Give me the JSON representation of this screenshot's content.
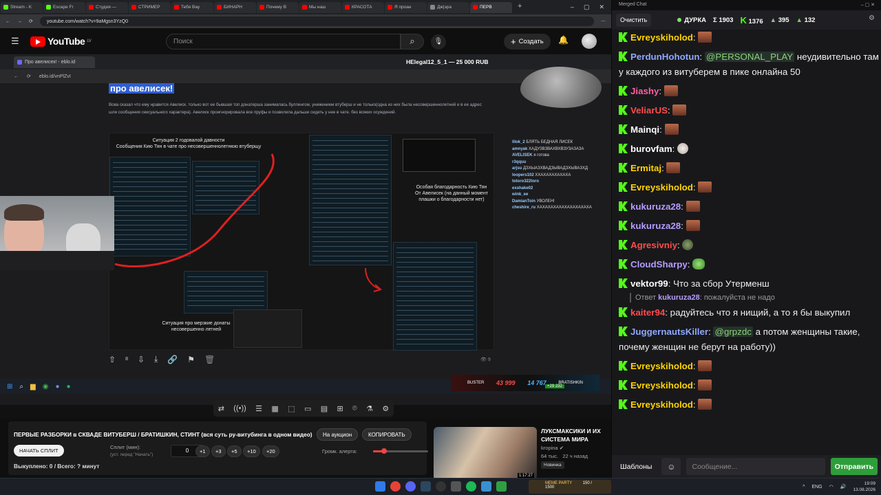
{
  "browser": {
    "tabs": [
      {
        "label": "Stream - K",
        "color": "#53fc18"
      },
      {
        "label": "Escape Fr",
        "color": "#53fc18"
      },
      {
        "label": "Студия —",
        "color": "#ff0000"
      },
      {
        "label": "СТРИМЕР",
        "color": "#ff0000"
      },
      {
        "label": "Тебя Вау",
        "color": "#ff0000"
      },
      {
        "label": "БИНАРН",
        "color": "#ff0000"
      },
      {
        "label": "Почему В",
        "color": "#ff0000"
      },
      {
        "label": "Мы наш",
        "color": "#ff0000"
      },
      {
        "label": "КРАСОТА",
        "color": "#ff0000"
      },
      {
        "label": "Я проан",
        "color": "#ff0000"
      },
      {
        "label": "Дж|эра",
        "color": "#888888"
      },
      {
        "label": "ПЕРВ",
        "color": "#ff0000"
      }
    ],
    "url": "youtube.com/watch?v=9aMgsn3YzQ0"
  },
  "youtube": {
    "logo": "YouTube",
    "region": "LV",
    "search_placeholder": "Поиск",
    "create_label": "Создать"
  },
  "video": {
    "inner_tab": "Про авелисек! - eblo.id",
    "inner_title": "HElegal12_5_1 — 25 000 RUB",
    "inner_url": "eblo.id/vnPlZvI",
    "article_heading": "про авелисек!",
    "article_text": "Вова сказал что ему нравится Авелиск. только вот ее бывшая топ донатерша занималась буллингом, унижением втуберш и не только(одна из них была несовершеннолетней и в ее адрес шли сообщения сексуального характера). Авелиск проигнорировала все пруфы и позволила дальше сидеть у нее в чате. без всяких осуждений.",
    "caption_1": "Ситуация 2 годовалой давности\nСообщения Кию Тян в чате про несовершеннолетнюю втуберщу",
    "caption_2": "Особая благодарность Кию Тян\nОт Авелисек (на данный момент\nплашки о благодарности нет)",
    "caption_3": "Ситуация про мерзкие донаты\nнесовершенно летней",
    "feed": [
      {
        "user": "lilok_2",
        "text": "БЛЯТЬ БЕДНАЯ ЛИСЕК"
      },
      {
        "user": "amnyak",
        "text": "ХАДУЗВЗВАХВХВЗУЗАЗАЗА"
      },
      {
        "user": "AVELISEK",
        "text": "я готова"
      },
      {
        "user": "r3qquu",
        "text": ""
      },
      {
        "user": "arjsu",
        "text": "ДЗХЫАЗХВАДЗЫВАДЗХЫВАЗХД"
      },
      {
        "user": "loopers102",
        "text": "ХХАХАХАХАХАХА"
      },
      {
        "user": "totoro322toro",
        "text": ""
      },
      {
        "user": "exshake02",
        "text": ""
      },
      {
        "user": "wink_ee",
        "text": ""
      },
      {
        "user": "DamianToin",
        "text": "УВОЛЕН!"
      },
      {
        "user": "cheshire_ru",
        "text": "ХАХАХАХАХАХАХАХАХАХА"
      }
    ],
    "likes": "8",
    "views": "9",
    "score_left_name": "BUSTER",
    "score_left": "43 999",
    "score_right_name": "BRATISHKIN",
    "score_right": "14 767",
    "score_diff": "+29 232"
  },
  "auction": {
    "title": "ПЕРВЫЕ РАЗБОРКИ в СКВАДЕ ВИТУБЕРШ / БРАТИШКИН, СТИНТ (вся суть ру-витубинга в одном видео)",
    "on_auction": "На аукцион",
    "copy": "КОПИРОВАТЬ",
    "start_split": "НАЧАТЬ СПЛИТ",
    "split_label": "Сплит (мин):",
    "split_hint": "(уст. перед \"Начать\")",
    "split_value": "0",
    "increments": [
      "+1",
      "+3",
      "+5",
      "+10",
      "+20"
    ],
    "volume_label": "Громк. алерта:",
    "volume_level": 0.2,
    "bought": "Выкуплено: 0 / Всего: ? минут"
  },
  "recommendation": {
    "title": "ЛУКСМАКСИКИ И ИХ СИСТЕМА МИРА",
    "channel": "kropina",
    "views": "64 тыс.",
    "age": "22 ч назад",
    "badge": "Новинка",
    "duration": "1:17:27"
  },
  "taskbar": {
    "meme": "MEME PARTY",
    "meme_progress": "150 / 1500",
    "lang": "ENG",
    "time": "19:09",
    "date": "13.08.2026"
  },
  "chat": {
    "window_title": "Merged Chat",
    "clear": "Очистить",
    "channel": "ДУРКА",
    "stat_total": "1903",
    "stat_kick": "1376",
    "stat_a": "395",
    "stat_b": "132",
    "messages": [
      {
        "user": "Evreyskiholod",
        "color": "#ffd400",
        "text": "",
        "emote": "face"
      },
      {
        "user": "PerdunHohotun",
        "color": "#8fa8ff",
        "text": "неудивительно  там у каждого из витуберем в пике онлайна 50",
        "mention": "@PERSONAL_PLAY",
        "emote": ""
      },
      {
        "user": "Jiashy",
        "color": "#ff5fa2",
        "text": "",
        "emote": "face"
      },
      {
        "user": "VeliarUS",
        "color": "#ff4c4c",
        "text": "",
        "emote": "face"
      },
      {
        "user": "Mainqi",
        "color": "#ffffff",
        "text": "",
        "emote": "face"
      },
      {
        "user": "burovfam",
        "color": "#ffffff",
        "text": "",
        "emote": "round"
      },
      {
        "user": "Ermitaj",
        "color": "#ffd400",
        "text": "",
        "emote": "face"
      },
      {
        "user": "Evreyskiholod",
        "color": "#ffd400",
        "text": "",
        "emote": "face"
      },
      {
        "user": "kukuruza28",
        "color": "#b59cff",
        "text": "",
        "emote": "face"
      },
      {
        "user": "kukuruza28",
        "color": "#b59cff",
        "text": "",
        "emote": "face"
      },
      {
        "user": "Agresivniy",
        "color": "#ff4c4c",
        "text": "",
        "emote": "alien"
      },
      {
        "user": "CloudSharpy",
        "color": "#b59cff",
        "text": "",
        "emote": "frog"
      },
      {
        "user": "vektor99",
        "color": "#ffffff",
        "text": "Что за сбор Утерменш",
        "emote": ""
      },
      {
        "user": "kaiter94",
        "color": "#ff4c4c",
        "text": "радуйтесь что я нищий, а то я бы выкупил",
        "emote": ""
      },
      {
        "user": "JuggernautsKiller",
        "color": "#8fa8ff",
        "text": "а потом женщины такие, почему женщин не берут на работу))",
        "mention": "@grpzdc",
        "emote": ""
      },
      {
        "user": "Evreyskiholod",
        "color": "#ffd400",
        "text": "",
        "emote": "face"
      },
      {
        "user": "Evreyskiholod",
        "color": "#ffd400",
        "text": "",
        "emote": "face"
      },
      {
        "user": "Evreyskiholod",
        "color": "#ffd400",
        "text": "",
        "emote": "face"
      }
    ],
    "reply_prefix": "Ответ",
    "reply_user": "kukuruza28",
    "reply_text": "пожалуйста не надо",
    "templates": "Шаблоны",
    "input_placeholder": "Сообщение...",
    "send": "Отправить"
  }
}
